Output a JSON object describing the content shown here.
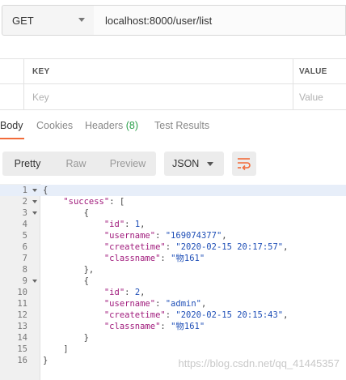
{
  "request": {
    "method": "GET",
    "url": "localhost:8000/user/list"
  },
  "params_table": {
    "key_header": "KEY",
    "value_header": "VALUE",
    "key_placeholder": "Key",
    "value_placeholder": "Value"
  },
  "response_tabs": {
    "body": "Body",
    "cookies": "Cookies",
    "headers": "Headers",
    "headers_count": "(8)",
    "test_results": "Test Results"
  },
  "view_modes": {
    "pretty": "Pretty",
    "raw": "Raw",
    "preview": "Preview",
    "format": "JSON"
  },
  "code_lines": [
    {
      "num": "1",
      "fold": true,
      "text": "{"
    },
    {
      "num": "2",
      "fold": true,
      "text": "    \"success\": ["
    },
    {
      "num": "3",
      "fold": true,
      "text": "        {"
    },
    {
      "num": "4",
      "fold": false,
      "text": "            \"id\": 1,"
    },
    {
      "num": "5",
      "fold": false,
      "text": "            \"username\": \"169074377\","
    },
    {
      "num": "6",
      "fold": false,
      "text": "            \"createtime\": \"2020-02-15 20:17:57\","
    },
    {
      "num": "7",
      "fold": false,
      "text": "            \"classname\": \"物161\""
    },
    {
      "num": "8",
      "fold": false,
      "text": "        },"
    },
    {
      "num": "9",
      "fold": true,
      "text": "        {"
    },
    {
      "num": "10",
      "fold": false,
      "text": "            \"id\": 2,"
    },
    {
      "num": "11",
      "fold": false,
      "text": "            \"username\": \"admin\","
    },
    {
      "num": "12",
      "fold": false,
      "text": "            \"createtime\": \"2020-02-15 20:15:43\","
    },
    {
      "num": "13",
      "fold": false,
      "text": "            \"classname\": \"物161\""
    },
    {
      "num": "14",
      "fold": false,
      "text": "        }"
    },
    {
      "num": "15",
      "fold": false,
      "text": "    ]"
    },
    {
      "num": "16",
      "fold": false,
      "text": "}"
    }
  ],
  "watermark": "https://blog.csdn.net/qq_41445357",
  "colors": {
    "accent": "#f26b3a",
    "count_green": "#2aa04a",
    "json_key": "#a01b7c",
    "json_value": "#1f4fb7"
  }
}
